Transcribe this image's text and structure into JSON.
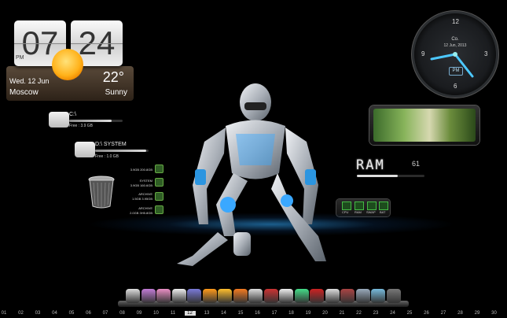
{
  "clock": {
    "hour": "07",
    "minute": "24",
    "ampm": "PM"
  },
  "weather": {
    "date": "Wed. 12 Jun",
    "city": "Moscow",
    "temp": "22°",
    "condition": "Sunny",
    "icon": "sun-icon"
  },
  "analog_clock": {
    "label": "Co.",
    "date": "12 Jun, 2013",
    "ampm": "PM",
    "numbers": [
      "12",
      "3",
      "6",
      "9"
    ]
  },
  "drives": [
    {
      "name": "C:\\",
      "free": "Free  :  3.9 GB",
      "used_fraction": 0.8
    },
    {
      "name": "D:\\ SYSTEM",
      "free": "Free  :  1.0 GB",
      "used_fraction": 0.95
    }
  ],
  "system_stats": [
    {
      "line1": "3.9GB  200.8GB"
    },
    {
      "line1": "SYSTEM",
      "line2": "3.9GB  160.6GB"
    },
    {
      "line1": "ARCHIVE",
      "line2": "1.5GB  3.95GB"
    },
    {
      "line1": "ARCHIVE",
      "line2": "2.0GB  3H5.8GB"
    }
  ],
  "ram": {
    "label": "RAM",
    "value": "61",
    "used_fraction": 0.61
  },
  "meters": {
    "labels": [
      "CPU",
      "RAM",
      "SWAP",
      "BAT"
    ]
  },
  "dock": {
    "icons": [
      "clock-icon",
      "music-note-icon",
      "gamepad-icon",
      "printer-icon",
      "pen-icon",
      "disc-icon",
      "camera-icon",
      "rss-icon",
      "document-icon",
      "download-icon",
      "soccer-ball-icon",
      "cube-icon",
      "gift-icon",
      "trash-icon",
      "box-icon",
      "mobile-icon",
      "photo-icon",
      "shutdown-icon"
    ]
  },
  "days": {
    "list": [
      "01",
      "02",
      "03",
      "04",
      "05",
      "06",
      "07",
      "08",
      "09",
      "10",
      "11",
      "12",
      "13",
      "14",
      "15",
      "16",
      "17",
      "18",
      "19",
      "20",
      "21",
      "22",
      "23",
      "24",
      "25",
      "26",
      "27",
      "28",
      "29",
      "30"
    ],
    "current": "12"
  },
  "colors": {
    "accent": "#3aa8ff",
    "background": "#000000"
  }
}
